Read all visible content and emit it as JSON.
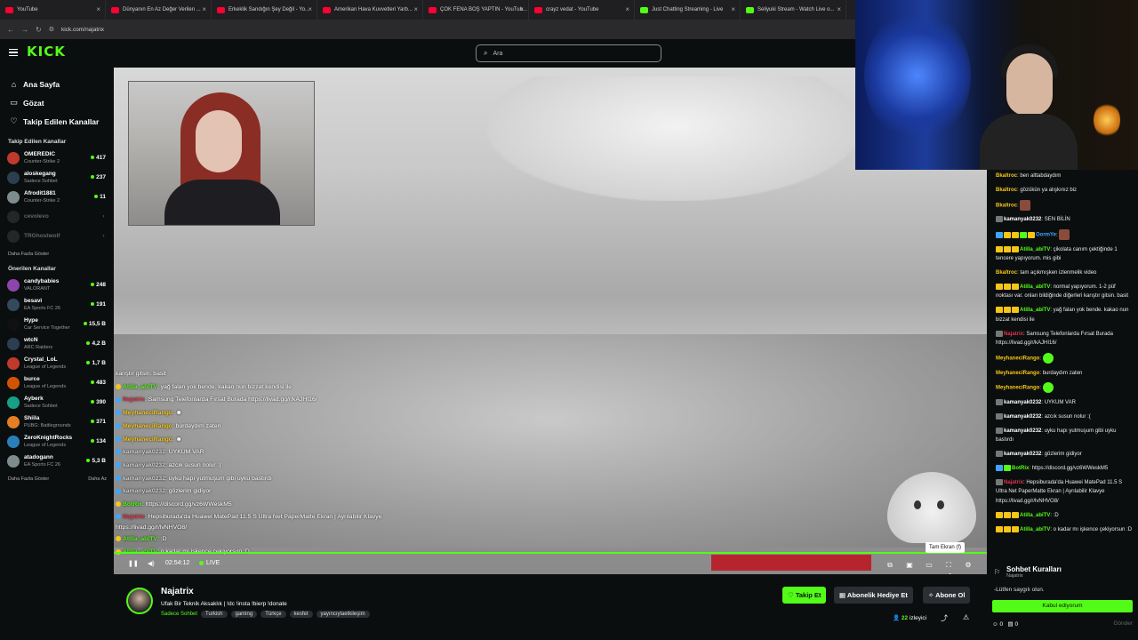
{
  "browser": {
    "tabs": [
      {
        "label": "YouTube",
        "icon": "youtube-icon"
      },
      {
        "label": "Dünyanın En Az Değer Verilen ...",
        "icon": "youtube-icon"
      },
      {
        "label": "Erkeklik Sandığın Şey Değil - Yo...",
        "icon": "youtube-icon"
      },
      {
        "label": "Amerikan Hava Kuvvetleri Yarb...",
        "icon": "youtube-icon"
      },
      {
        "label": "ÇOK FENA BOŞ YAPTIN - YouTub...",
        "icon": "youtube-icon"
      },
      {
        "label": "crayz vedat - YouTube",
        "icon": "youtube-icon"
      },
      {
        "label": "Just Chatting Streaming - Live",
        "icon": "kick-icon"
      },
      {
        "label": "Seliyuki Stream - Watch Live o...",
        "icon": "kick-icon"
      }
    ],
    "url": "kick.com/najatrix"
  },
  "header": {
    "logo": "KICK",
    "search_placeholder": "Ara"
  },
  "sidebar": {
    "nav": [
      {
        "label": "Ana Sayfa",
        "icon": "home-icon"
      },
      {
        "label": "Gözat",
        "icon": "browse-icon"
      },
      {
        "label": "Takip Edilen Kanallar",
        "icon": "heart-icon"
      }
    ],
    "followed_title": "Takip Edilen Kanallar",
    "followed": [
      {
        "name": "OMEREDIC",
        "category": "Counter-Strike 2",
        "viewers": "417",
        "color": "#c0392b"
      },
      {
        "name": "aloskegang",
        "category": "Sadece Sohbet",
        "viewers": "237",
        "color": "#2c3e50"
      },
      {
        "name": "Afrodit1881",
        "category": "Counter-Strike 2",
        "viewers": "11",
        "color": "#7f8c8d"
      },
      {
        "name": "cevolevo",
        "category": "",
        "viewers": "",
        "color": "#555"
      },
      {
        "name": "TRGhostwolf",
        "category": "",
        "viewers": "",
        "color": "#555"
      }
    ],
    "followed_more": "Daha Fazla Göster",
    "recommended_title": "Önerilen Kanallar",
    "recommended": [
      {
        "name": "candybabies",
        "category": "VALORANT",
        "viewers": "248",
        "color": "#8e44ad"
      },
      {
        "name": "besavi",
        "category": "EA Sports FC 26",
        "viewers": "191",
        "color": "#34495e"
      },
      {
        "name": "Hype",
        "category": "Car Service Together",
        "viewers": "15,5 B",
        "color": "#111"
      },
      {
        "name": "wtcN",
        "category": "ARC Raiders",
        "viewers": "4,2 B",
        "color": "#2c3e50"
      },
      {
        "name": "Crystal_LoL",
        "category": "League of Legends",
        "viewers": "1,7 B",
        "color": "#c0392b"
      },
      {
        "name": "burce",
        "category": "League of Legends",
        "viewers": "483",
        "color": "#d35400"
      },
      {
        "name": "Ayberk",
        "category": "Sadece Sohbet",
        "viewers": "390",
        "color": "#16a085"
      },
      {
        "name": "Shiila",
        "category": "PUBG: Battlegrounds",
        "viewers": "371",
        "color": "#e67e22"
      },
      {
        "name": "ZeroKnightRocks",
        "category": "League of Legends",
        "viewers": "134",
        "color": "#2980b9"
      },
      {
        "name": "atadogann",
        "category": "EA Sports FC 26",
        "viewers": "5,3 B",
        "color": "#7f8c8d"
      }
    ],
    "more_left": "Daha Fazla Göster",
    "more_right": "Daha Az"
  },
  "video": {
    "overlay_chat": [
      {
        "user": "",
        "text": "karıştır gitsin. basit",
        "ucolor": "gr"
      },
      {
        "user": "Atilla_abiTV",
        "text": ": yağ falan yok bende. kakao nun bizzat kendisi ile",
        "ucolor": "g"
      },
      {
        "user": "Najatrix",
        "text": ": Samsung Telefonlarda Fırsat Burada https://livad.gg/r/kAJHI16/",
        "ucolor": "r"
      },
      {
        "user": "MeyhaneciRango",
        "text": ": ☻",
        "ucolor": "y"
      },
      {
        "user": "MeyhaneciRango",
        "text": ": burdaydım zaten",
        "ucolor": "y"
      },
      {
        "user": "MeyhaneciRango",
        "text": ": ☻",
        "ucolor": "y"
      },
      {
        "user": "kamanyak0232",
        "text": ": UYKUM VAR",
        "ucolor": "gr"
      },
      {
        "user": "kamanyak0232",
        "text": ": azcık susun nolur :(",
        "ucolor": "gr"
      },
      {
        "user": "kamanyak0232",
        "text": ": uyku hapı yutmuşum gibi uyku bastırdı",
        "ucolor": "gr"
      },
      {
        "user": "kamanyak0232",
        "text": ": gözlerim gidiyor",
        "ucolor": "gr"
      },
      {
        "user": "BotRix",
        "text": ": https://discord.gg/vz6WWeskM5",
        "ucolor": "g"
      },
      {
        "user": "Najatrix",
        "text": ": Hepsiburada'da Huawei MatePad 11.5 S Ultra Net PaperMatte Ekran | Ayrılabilir Klavye https://livad.gg/r/lvNHVO8/",
        "ucolor": "r"
      },
      {
        "user": "Atilla_abiTV",
        "text": ": :D",
        "ucolor": "g"
      },
      {
        "user": "Atilla_abiTV",
        "text": ": o kadar mı işkence çekiyorsun :D",
        "ucolor": "g"
      }
    ],
    "time": "02:54:12",
    "live_label": "LIVE",
    "tooltip": "Tam Ekran (f)",
    "progress": 1.0
  },
  "chat": {
    "messages": [
      {
        "user": "Bkaltroc",
        "text": ": ben alttabdaydım",
        "badges": []
      },
      {
        "user": "Bkaltroc",
        "text": ": gözükün ya alışkınız biz",
        "badges": []
      },
      {
        "user": "Bkaltroc",
        "text": ":",
        "badges": [],
        "emote": "brown"
      },
      {
        "user": "kamanyak0232",
        "text": ": SEN BİLİN",
        "badges": [
          "gray"
        ]
      },
      {
        "user": "OormYe",
        "text": ":",
        "badges": [
          "b",
          "y",
          "y",
          "g",
          "y"
        ],
        "emote": "brown"
      },
      {
        "user": "Atilla_abiTV",
        "text": ": çikolata canım çektiğinde 1 tencere yapıyorum. mis gibi",
        "badges": [
          "y",
          "y",
          "y"
        ]
      },
      {
        "user": "Bkaltroc",
        "text": ": tam açıkmışken izlenmelik video",
        "badges": []
      },
      {
        "user": "Atilla_abiTV",
        "text": ": normal yapıyorum. 1-2 püf noktası var. onları bildiğinde diğerleri karıştır gitsin. basit",
        "badges": [
          "y",
          "y",
          "y"
        ]
      },
      {
        "user": "Atilla_abiTV",
        "text": ": yağ falan yok bende. kakao nun bizzat kendisi ile",
        "badges": [
          "y",
          "y",
          "y"
        ]
      },
      {
        "user": "Najatrix",
        "text": ": Samsung Telefonlarda Fırsat Burada https://livad.gg/r/kAJHI16/",
        "badges": [
          "r"
        ]
      },
      {
        "user": "MeyhaneciRango",
        "text": ":",
        "badges": [],
        "emote": "green"
      },
      {
        "user": "MeyhaneciRango",
        "text": ": burdaydım zaten",
        "badges": []
      },
      {
        "user": "MeyhaneciRango",
        "text": ":",
        "badges": [],
        "emote": "green"
      },
      {
        "user": "kamanyak0232",
        "text": ": UYKUM VAR",
        "badges": [
          "gray"
        ]
      },
      {
        "user": "kamanyak0232",
        "text": ": azcık susun nolur :(",
        "badges": [
          "gray"
        ]
      },
      {
        "user": "kamanyak0232",
        "text": ": uyku hapı yutmuşum gibi uyku bastırdı",
        "badges": [
          "gray"
        ]
      },
      {
        "user": "kamanyak0232",
        "text": ": gözlerim gidiyor",
        "badges": [
          "gray"
        ]
      },
      {
        "user": "BotRix",
        "text": ": https://discord.gg/vz6WWeskM5",
        "badges": [
          "b",
          "g"
        ]
      },
      {
        "user": "Najatrix",
        "text": ": Hepsiburada'da Huawei MatePad 11.5 S Ultra Net PaperMatte Ekran | Ayrılabilir Klavye https://livad.gg/r/lvNHVO8/",
        "badges": [
          "r"
        ]
      },
      {
        "user": "Atilla_abiTV",
        "text": ": :D",
        "badges": [
          "y",
          "y",
          "y"
        ]
      },
      {
        "user": "Atilla_abiTV",
        "text": ": o kadar mı işkence çekiyorsun :D",
        "badges": [
          "y",
          "y",
          "y"
        ]
      }
    ],
    "rules_title": "Sohbet Kuralları",
    "rules_sub": "Najatrix",
    "rule_1": "-Lütfen saygılı olun.",
    "accept_label": "Kabul ediyorum",
    "counter_a": "0",
    "counter_b": "0",
    "send_label": "Gönder"
  },
  "stream_info": {
    "name": "Najatrix",
    "title": "Ufak Bir Teknik Aksaklık | !dc !insta !bierp !donate",
    "category": "Sadece Sohbet",
    "tags": [
      "Turkish",
      "gaming",
      "Türkçe",
      "kesfet",
      "yayıncıylaetkileşim"
    ],
    "follow_label": "Takip Et",
    "gift_label": "Abonelik Hediye Et",
    "sub_label": "Abone Ol",
    "viewers": "22",
    "viewers_label": "izleyici"
  },
  "colors": {
    "accent": "#53fc18",
    "background": "#0b0e0f"
  }
}
